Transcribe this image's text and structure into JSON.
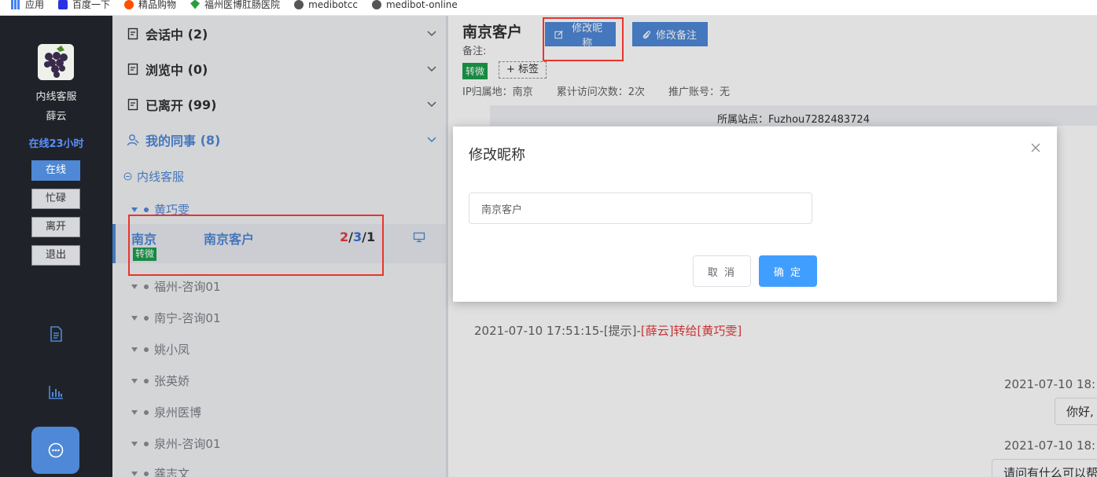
{
  "bookmarks": [
    {
      "label": "应用",
      "icon": "apps-grid-icon"
    },
    {
      "label": "百度一下",
      "icon": "baidu-icon"
    },
    {
      "label": "精品购物",
      "icon": "shopping-icon"
    },
    {
      "label": "福州医博肛肠医院",
      "icon": "leaf-icon"
    },
    {
      "label": "medibotcc",
      "icon": "globe-icon"
    },
    {
      "label": "medibot-online",
      "icon": "globe-icon"
    }
  ],
  "rail": {
    "role": "内线客服",
    "name": "薛云",
    "online_time": "在线23小时",
    "status_buttons": [
      "在线",
      "忙碌",
      "离开",
      "退出"
    ]
  },
  "list": {
    "groups": [
      {
        "label": "会话中",
        "count": "(2)"
      },
      {
        "label": "浏览中",
        "count": "(0)"
      },
      {
        "label": "已离开",
        "count": "(99)"
      },
      {
        "label": "我的同事",
        "count": "(8)"
      }
    ],
    "subgroup": "内线客服",
    "members": [
      "黄巧雯",
      "福州-咨询01",
      "南宁-咨询01",
      "姚小凤",
      "张英娇",
      "泉州医博",
      "泉州-咨询01",
      "龚志文"
    ],
    "session": {
      "city": "南京",
      "customer": "南京客户",
      "count_a": "2",
      "count_b": "3",
      "count_c": "1",
      "slash": "/",
      "tag": "转微"
    }
  },
  "main": {
    "customer_title": "南京客户",
    "edit_nickname_btn": "修改昵称",
    "edit_note_btn": "修改备注",
    "note_label": "备注:",
    "tag": "转微",
    "add_tag": "+ 标签",
    "ip_location": "IP归属地：南京",
    "visit_count": "累计访问次数：2次",
    "promo_account": "推广账号：无",
    "site": "所属站点：Fuzhou7282483724",
    "system_message": {
      "prefix": "2021-07-10 17:51:15-[提示]-",
      "highlight": "[薛云]转给[黄巧雯]"
    },
    "timestamp_1": "2021-07-10 18:",
    "bubble_1": "你好,",
    "timestamp_2": "2021-07-10 18:",
    "bubble_2": "请问有什么可以帮"
  },
  "dialog": {
    "title": "修改昵称",
    "input_value": "南京客户",
    "cancel": "取 消",
    "confirm": "确 定"
  },
  "colors": {
    "rail_bg": "#1f2329",
    "accent": "#4e88d6",
    "primary": "#409eff",
    "tag_green": "#1c9e4a",
    "highlight_red": "#e8352e"
  }
}
